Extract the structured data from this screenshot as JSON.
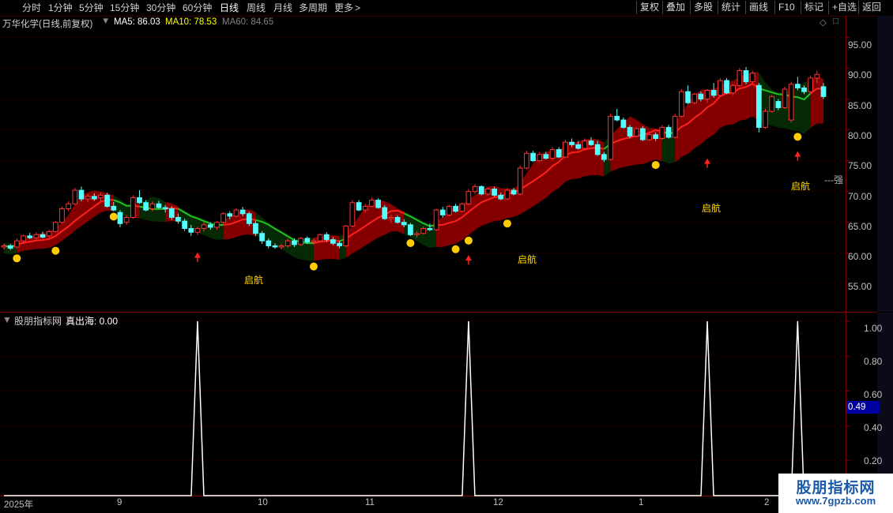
{
  "toolbar": {
    "timeframes": [
      "分时",
      "1分钟",
      "5分钟",
      "15分钟",
      "30分钟",
      "60分钟",
      "日线",
      "周线",
      "月线",
      "多周期",
      "更多"
    ],
    "active": "日线",
    "more_arrow": ">",
    "right_buttons": [
      "复权",
      "叠加",
      "多股",
      "统计",
      "画线",
      "F10",
      "标记",
      "+自选",
      "返回"
    ]
  },
  "stock_info": {
    "name": "万华化学(日线,前复权)",
    "ma5_label": "MA5: 86.03",
    "ma10_label": "MA10: 78.53",
    "ma60_label": "MA60: 84.65",
    "colors": {
      "ma5": "#ffffff",
      "ma10": "#ffff00",
      "ma60": "#808080"
    }
  },
  "main_axis": {
    "ticks": [
      "95.00",
      "90.00",
      "85.00",
      "80.00",
      "75.00",
      "70.00",
      "65.00",
      "60.00",
      "55.00"
    ],
    "right_mark": "---强"
  },
  "signal_labels": [
    "启航",
    "启航",
    "启航",
    "启航"
  ],
  "indicator": {
    "title": "股朋指标网",
    "value_label": "真出海: 0.00",
    "ticks": [
      "1.00",
      "0.80",
      "0.60",
      "0.40",
      "0.20"
    ],
    "badge": "0.49"
  },
  "date_axis": [
    "2025年",
    "9",
    "10",
    "11",
    "12",
    "1",
    "2"
  ],
  "watermark": {
    "line1": "股朋指标网",
    "line2": "www.7gpzb.com"
  },
  "chart_data": [
    {
      "type": "candlestick",
      "ylim": [
        50.5,
        98.5
      ],
      "y_ticks": [
        55,
        60,
        65,
        70,
        75,
        80,
        85,
        90,
        95
      ],
      "candles_ohlc": [
        [
          61.0,
          61.6,
          60.6,
          61.2
        ],
        [
          61.2,
          61.5,
          60.5,
          60.8
        ],
        [
          61.0,
          62.4,
          60.8,
          62.0
        ],
        [
          62.0,
          63.0,
          61.5,
          62.8
        ],
        [
          62.8,
          63.3,
          62.3,
          62.5
        ],
        [
          62.5,
          63.4,
          62.2,
          63.0
        ],
        [
          63.0,
          63.5,
          62.4,
          62.6
        ],
        [
          62.8,
          63.8,
          62.5,
          63.5
        ],
        [
          63.5,
          65.2,
          63.4,
          65.0
        ],
        [
          65.0,
          67.5,
          64.8,
          67.2
        ],
        [
          67.2,
          68.4,
          66.8,
          68.0
        ],
        [
          68.0,
          70.6,
          67.8,
          70.2
        ],
        [
          70.2,
          70.8,
          68.4,
          68.8
        ],
        [
          68.8,
          69.6,
          68.3,
          69.2
        ],
        [
          69.2,
          69.7,
          68.5,
          68.8
        ],
        [
          69.0,
          69.8,
          68.4,
          69.4
        ],
        [
          69.4,
          69.8,
          67.4,
          67.6
        ],
        [
          67.6,
          68.3,
          66.8,
          67.0
        ],
        [
          66.6,
          67.0,
          64.2,
          64.8
        ],
        [
          65.0,
          66.2,
          64.6,
          65.8
        ],
        [
          65.8,
          69.4,
          65.6,
          69.0
        ],
        [
          69.0,
          70.2,
          68.0,
          68.2
        ],
        [
          68.2,
          68.6,
          66.8,
          67.0
        ],
        [
          67.2,
          68.4,
          66.8,
          68.0
        ],
        [
          68.0,
          68.5,
          67.2,
          67.4
        ],
        [
          67.4,
          67.8,
          66.6,
          67.2
        ],
        [
          67.2,
          67.6,
          65.4,
          65.8
        ],
        [
          65.8,
          66.4,
          64.8,
          65.2
        ],
        [
          65.2,
          65.6,
          63.6,
          64.0
        ],
        [
          64.0,
          64.6,
          62.8,
          63.4
        ],
        [
          63.4,
          64.3,
          62.9,
          64.0
        ],
        [
          64.0,
          65.0,
          63.5,
          64.6
        ],
        [
          64.6,
          65.0,
          63.8,
          64.2
        ],
        [
          64.2,
          65.2,
          63.8,
          65.0
        ],
        [
          65.0,
          66.6,
          64.8,
          66.4
        ],
        [
          66.4,
          66.8,
          65.5,
          66.0
        ],
        [
          66.0,
          67.3,
          65.8,
          67.0
        ],
        [
          67.0,
          67.5,
          66.0,
          66.4
        ],
        [
          66.4,
          66.7,
          64.4,
          64.8
        ],
        [
          64.8,
          65.2,
          62.8,
          63.2
        ],
        [
          63.2,
          63.6,
          61.5,
          62.0
        ],
        [
          62.0,
          62.4,
          60.8,
          61.2
        ],
        [
          61.2,
          61.6,
          60.7,
          61.0
        ],
        [
          61.0,
          61.5,
          60.6,
          61.2
        ],
        [
          61.2,
          62.3,
          60.9,
          62.0
        ],
        [
          62.0,
          62.4,
          61.0,
          61.4
        ],
        [
          61.4,
          62.6,
          61.2,
          62.4
        ],
        [
          62.4,
          62.7,
          61.5,
          61.8
        ],
        [
          61.8,
          62.4,
          61.4,
          62.0
        ],
        [
          62.0,
          63.2,
          61.8,
          63.0
        ],
        [
          63.0,
          63.4,
          61.8,
          62.2
        ],
        [
          62.2,
          62.6,
          61.3,
          61.6
        ],
        [
          61.6,
          62.0,
          60.8,
          61.2
        ],
        [
          61.2,
          64.6,
          61.0,
          64.4
        ],
        [
          64.4,
          68.6,
          64.2,
          68.2
        ],
        [
          68.2,
          68.6,
          66.8,
          67.0
        ],
        [
          67.0,
          68.0,
          66.6,
          67.6
        ],
        [
          67.6,
          69.0,
          67.4,
          68.6
        ],
        [
          68.6,
          68.9,
          67.2,
          67.4
        ],
        [
          67.4,
          67.8,
          65.4,
          65.6
        ],
        [
          65.6,
          66.2,
          64.9,
          65.8
        ],
        [
          65.8,
          66.1,
          64.8,
          65.0
        ],
        [
          65.0,
          65.5,
          64.2,
          64.6
        ],
        [
          64.6,
          64.9,
          62.8,
          63.0
        ],
        [
          63.0,
          63.6,
          62.5,
          63.2
        ],
        [
          63.2,
          64.3,
          63.0,
          64.0
        ],
        [
          64.0,
          64.8,
          63.6,
          63.8
        ],
        [
          63.8,
          67.2,
          63.6,
          67.0
        ],
        [
          67.0,
          67.5,
          65.8,
          66.2
        ],
        [
          66.2,
          67.8,
          66.0,
          67.6
        ],
        [
          67.6,
          68.0,
          66.6,
          66.8
        ],
        [
          66.8,
          68.2,
          66.6,
          68.0
        ],
        [
          68.0,
          70.4,
          67.8,
          70.0
        ],
        [
          70.0,
          71.2,
          69.6,
          70.8
        ],
        [
          70.8,
          71.0,
          69.4,
          69.6
        ],
        [
          69.6,
          70.6,
          69.3,
          70.4
        ],
        [
          70.4,
          70.8,
          69.2,
          69.4
        ],
        [
          69.4,
          69.8,
          68.6,
          68.8
        ],
        [
          68.8,
          70.6,
          68.6,
          70.2
        ],
        [
          70.2,
          70.6,
          69.4,
          69.6
        ],
        [
          69.6,
          74.2,
          69.4,
          73.8
        ],
        [
          73.8,
          76.6,
          73.6,
          76.2
        ],
        [
          76.2,
          76.6,
          74.8,
          75.0
        ],
        [
          75.0,
          76.4,
          74.8,
          76.0
        ],
        [
          76.0,
          76.4,
          75.2,
          75.4
        ],
        [
          75.4,
          77.2,
          75.0,
          76.8
        ],
        [
          76.8,
          77.2,
          75.4,
          75.6
        ],
        [
          75.6,
          78.4,
          75.4,
          78.0
        ],
        [
          78.0,
          78.6,
          77.2,
          77.6
        ],
        [
          77.6,
          78.2,
          76.8,
          77.0
        ],
        [
          77.0,
          78.6,
          76.8,
          78.2
        ],
        [
          78.2,
          78.8,
          77.4,
          77.6
        ],
        [
          77.6,
          78.2,
          75.8,
          76.0
        ],
        [
          76.0,
          76.4,
          74.8,
          75.2
        ],
        [
          75.2,
          82.6,
          75.0,
          82.2
        ],
        [
          82.2,
          83.4,
          81.4,
          81.6
        ],
        [
          81.6,
          82.0,
          80.2,
          80.4
        ],
        [
          80.4,
          80.8,
          78.6,
          79.0
        ],
        [
          79.0,
          80.4,
          78.8,
          80.2
        ],
        [
          80.2,
          80.6,
          78.2,
          78.4
        ],
        [
          78.4,
          79.4,
          78.2,
          79.2
        ],
        [
          79.2,
          79.6,
          78.2,
          78.6
        ],
        [
          78.6,
          80.8,
          78.4,
          80.4
        ],
        [
          80.4,
          80.8,
          78.6,
          78.8
        ],
        [
          78.8,
          82.6,
          78.6,
          82.2
        ],
        [
          82.2,
          86.6,
          82.0,
          86.2
        ],
        [
          86.2,
          87.2,
          84.2,
          84.4
        ],
        [
          84.4,
          86.0,
          84.2,
          85.8
        ],
        [
          85.8,
          86.2,
          84.6,
          85.0
        ],
        [
          85.0,
          86.6,
          84.4,
          86.4
        ],
        [
          86.4,
          87.6,
          85.2,
          85.6
        ],
        [
          85.6,
          88.4,
          85.4,
          88.0
        ],
        [
          88.0,
          88.4,
          85.8,
          86.0
        ],
        [
          86.0,
          87.4,
          85.6,
          87.2
        ],
        [
          87.2,
          90.0,
          87.0,
          89.6
        ],
        [
          89.6,
          90.2,
          87.4,
          87.8
        ],
        [
          87.8,
          89.6,
          87.6,
          89.2
        ],
        [
          87.2,
          87.6,
          79.6,
          80.4
        ],
        [
          80.4,
          83.4,
          80.2,
          83.0
        ],
        [
          83.0,
          85.6,
          82.8,
          85.4
        ],
        [
          84.6,
          85.0,
          83.2,
          83.6
        ],
        [
          83.6,
          87.0,
          83.4,
          86.6
        ],
        [
          81.6,
          87.8,
          81.2,
          87.4
        ],
        [
          87.4,
          88.6,
          86.4,
          86.8
        ],
        [
          86.8,
          87.2,
          85.8,
          86.2
        ],
        [
          86.2,
          88.8,
          86.0,
          88.4
        ],
        [
          88.4,
          89.6,
          87.6,
          89.0
        ],
        [
          87.0,
          87.6,
          85.0,
          85.4
        ]
      ],
      "ma_line_colors_by_segment": [
        "red",
        "green",
        "red",
        "green",
        "red"
      ],
      "signal_dots_bar_index": [
        2,
        8,
        17,
        48,
        63,
        70,
        72,
        78,
        101,
        123
      ],
      "qihang_arrow_bar_index": [
        30,
        72,
        109,
        123
      ]
    },
    {
      "type": "line",
      "name": "真出海",
      "ylim": [
        0,
        1.05
      ],
      "y_ticks": [
        0.2,
        0.4,
        0.6,
        0.8,
        1.0
      ],
      "spikes_at_bar_index": [
        30,
        72,
        109,
        123
      ],
      "spike_value": 1.0,
      "baseline": 0.0
    }
  ]
}
